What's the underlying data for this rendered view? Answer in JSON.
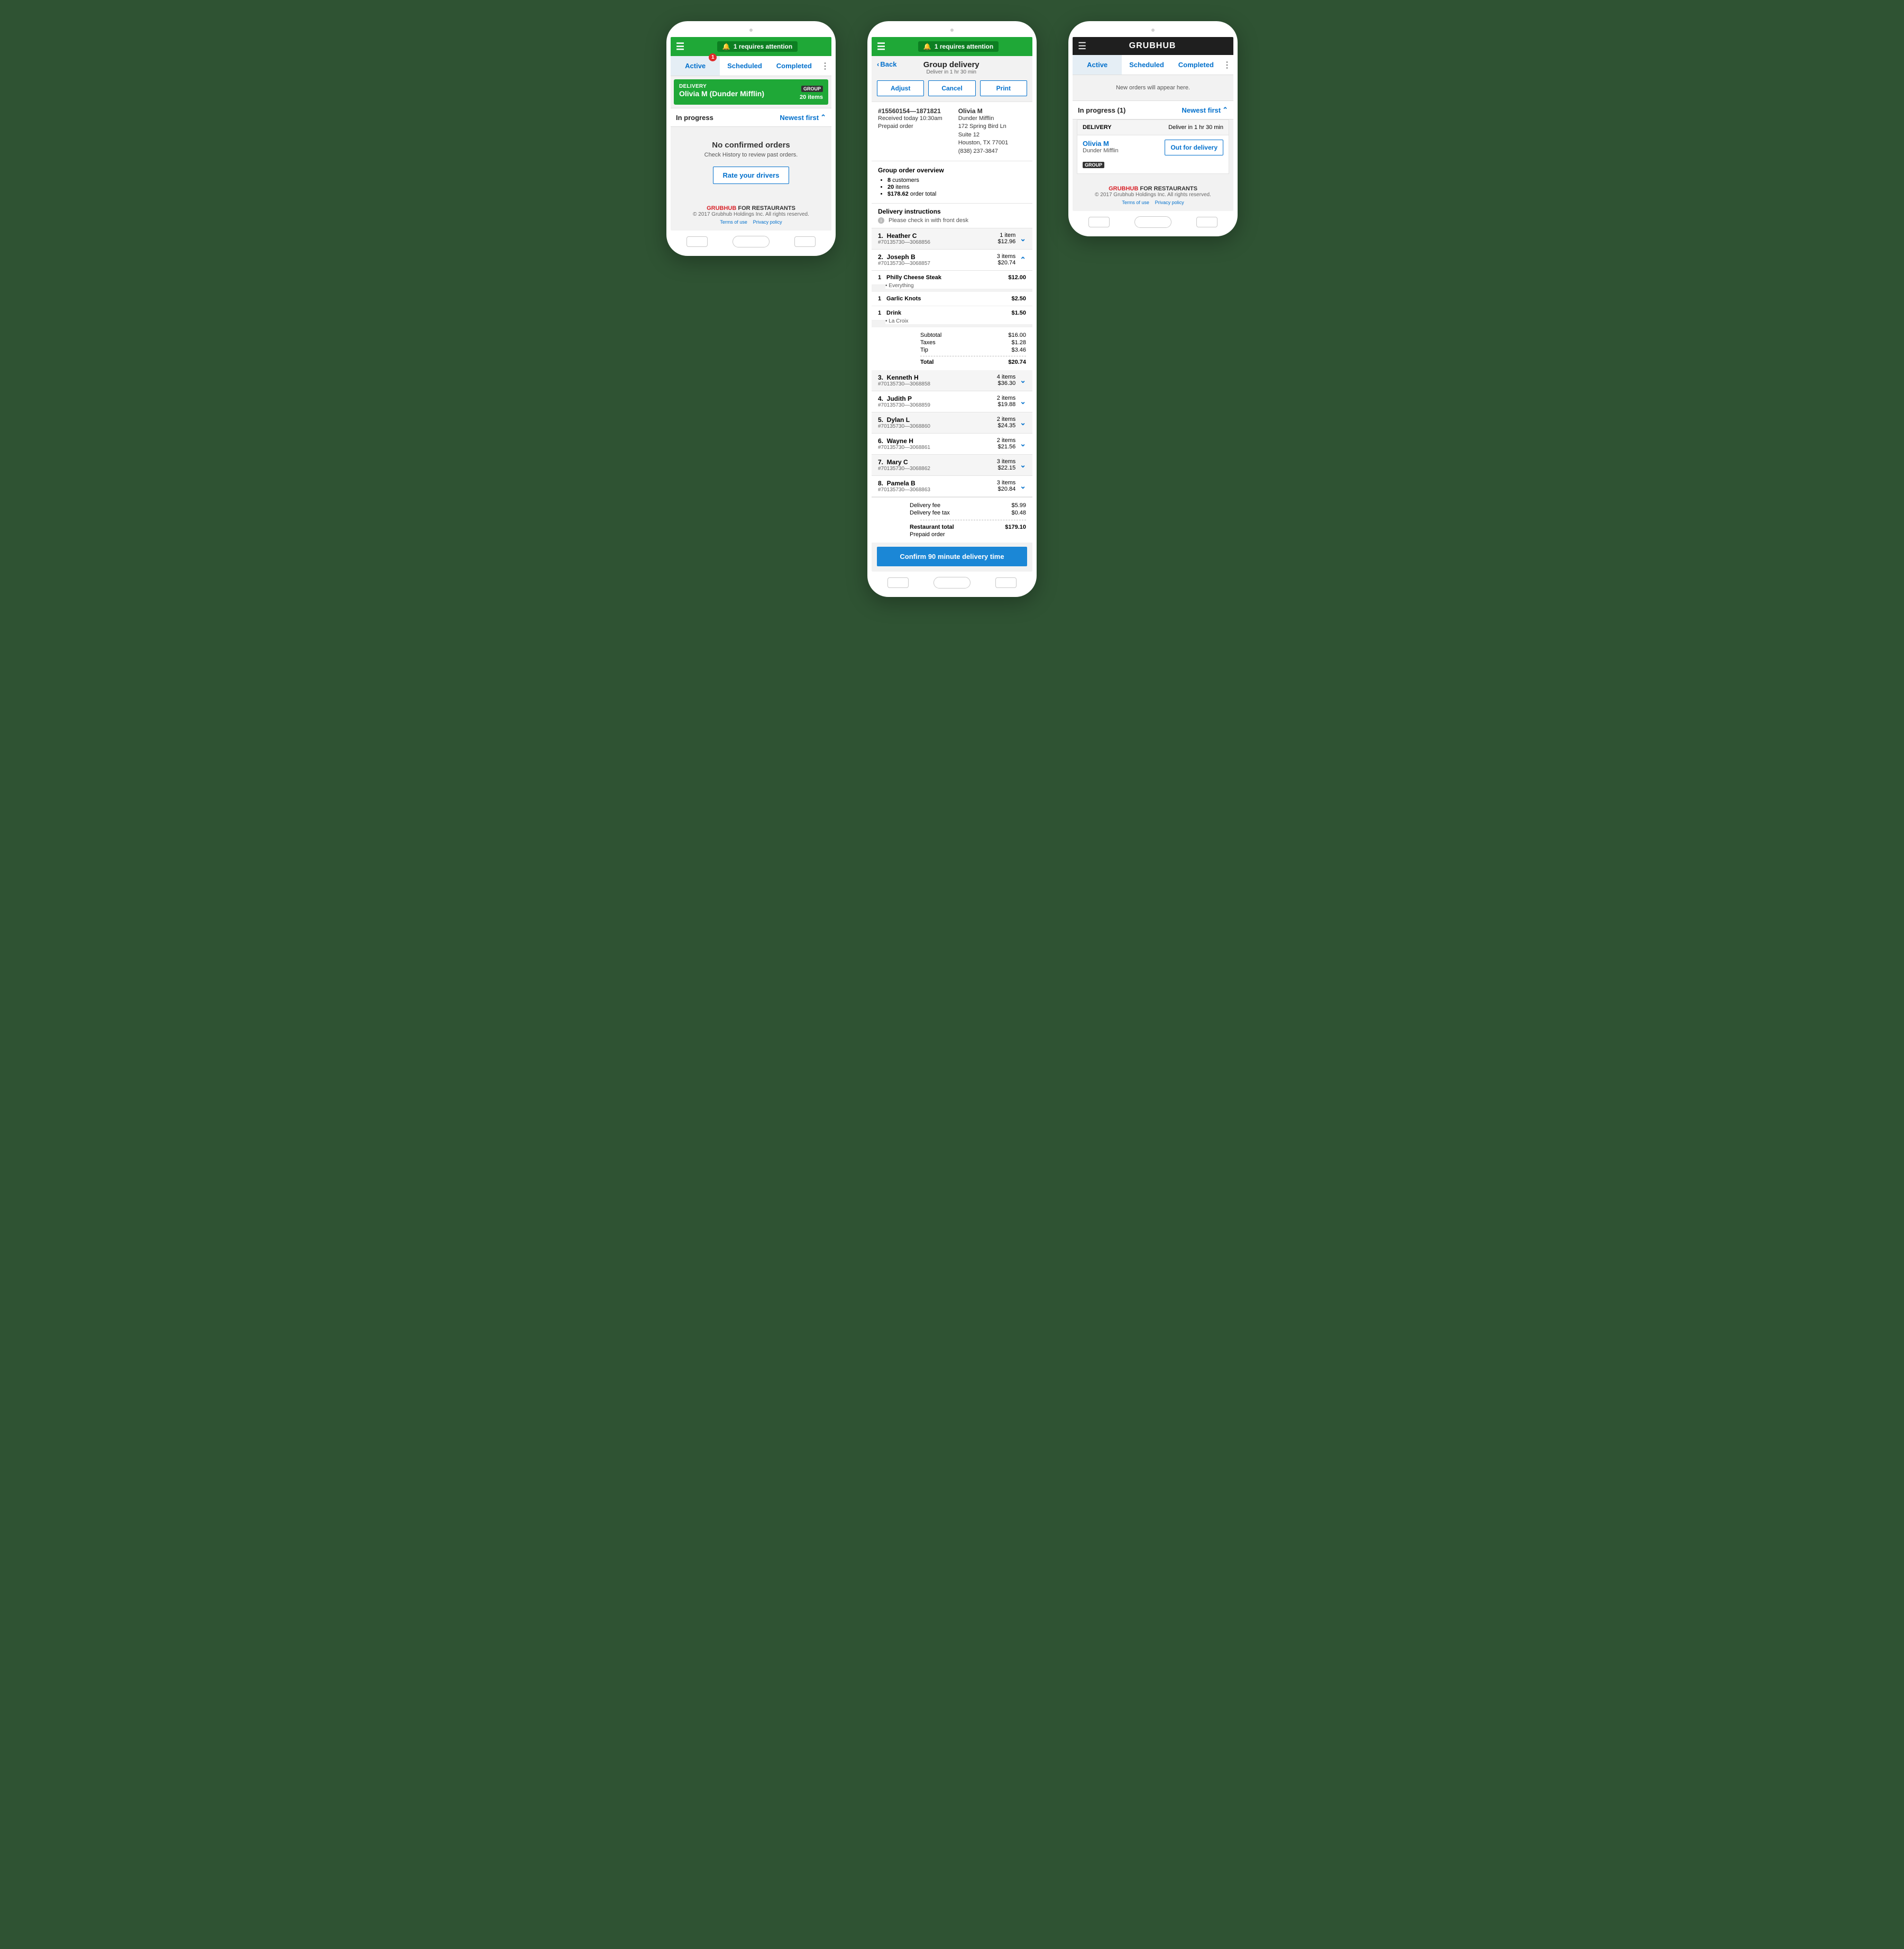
{
  "attention_text": "1 requires attention",
  "tabs": {
    "active": "Active",
    "scheduled": "Scheduled",
    "completed": "Completed",
    "badge": "1"
  },
  "phone1": {
    "card": {
      "type": "DELIVERY",
      "name": "Olivia M (Dunder Mifflin)",
      "badge": "GROUP",
      "items": "20 items"
    },
    "section": {
      "title": "In progress",
      "sort": "Newest first"
    },
    "empty": {
      "title": "No confirmed orders",
      "sub": "Check History to review past orders.",
      "button": "Rate your drivers"
    }
  },
  "footer": {
    "brand_red": "GRUBHUB",
    "brand_rest": " FOR RESTAURANTS",
    "copyright": "© 2017 Grubhub Holdings Inc. All rights reserved.",
    "terms": "Terms of use",
    "privacy": "Privacy policy"
  },
  "phone2": {
    "back": "Back",
    "title": "Group delivery",
    "subtitle": "Deliver in 1 hr 30 min",
    "actions": {
      "adjust": "Adjust",
      "cancel": "Cancel",
      "print": "Print"
    },
    "order_info": {
      "id": "#15560154—1871821",
      "received": "Received today 10:30am",
      "prepaid": "Prepaid order"
    },
    "customer": {
      "name": "Olivia M",
      "company": "Dunder Mifflin",
      "addr1": "172 Spring Bird Ln",
      "addr2": "Suite 12",
      "city": "Houston, TX 77001",
      "phone": "(838) 237-3847"
    },
    "overview": {
      "title": "Group order overview",
      "customers": {
        "n": "8",
        "label": " customers"
      },
      "items": {
        "n": "20",
        "label": " items"
      },
      "total": {
        "n": "$178.62",
        "label": " order total"
      }
    },
    "instructions": {
      "title": "Delivery instructions",
      "text": "Please check in with front desk"
    },
    "people": [
      {
        "idx": "1.",
        "name": "Heather C",
        "id": "#70135730—3068856",
        "count": "1 item",
        "amount": "$12.96",
        "open": false
      },
      {
        "idx": "2.",
        "name": "Joseph B",
        "id": "#70135730—3068857",
        "count": "3 items",
        "amount": "$20.74",
        "open": true
      },
      {
        "idx": "3.",
        "name": "Kenneth H",
        "id": "#70135730—3068858",
        "count": "4 items",
        "amount": "$36.30",
        "open": false
      },
      {
        "idx": "4.",
        "name": "Judith P",
        "id": "#70135730—3068859",
        "count": "2 items",
        "amount": "$19.88",
        "open": false
      },
      {
        "idx": "5.",
        "name": "Dylan L",
        "id": "#70135730—3068860",
        "count": "2 items",
        "amount": "$24.35",
        "open": false
      },
      {
        "idx": "6.",
        "name": "Wayne H",
        "id": "#70135730—3068861",
        "count": "2 items",
        "amount": "$21.56",
        "open": false
      },
      {
        "idx": "7.",
        "name": "Mary C",
        "id": "#70135730—3068862",
        "count": "3 items",
        "amount": "$22.15",
        "open": false
      },
      {
        "idx": "8.",
        "name": "Pamela B",
        "id": "#70135730—3068863",
        "count": "3 items",
        "amount": "$20.84",
        "open": false
      }
    ],
    "joseph_items": [
      {
        "qty": "1",
        "name": "Philly Cheese Steak",
        "price": "$12.00",
        "mods": "Everything"
      },
      {
        "qty": "1",
        "name": "Garlic Knots",
        "price": "$2.50"
      },
      {
        "qty": "1",
        "name": "Drink",
        "price": "$1.50",
        "mods": "La Croix"
      }
    ],
    "joseph_totals": {
      "subtotal_label": "Subtotal",
      "subtotal": "$16.00",
      "taxes_label": "Taxes",
      "taxes": "$1.28",
      "tip_label": "Tip",
      "tip": "$3.46",
      "total_label": "Total",
      "total": "$20.74"
    },
    "fees": {
      "dfee_label": "Delivery fee",
      "dfee": "$5.99",
      "dtax_label": "Delivery fee tax",
      "dtax": "$0.48",
      "rtotal_label": "Restaurant total",
      "rtotal": "$179.10",
      "prepaid": "Prepaid order"
    },
    "confirm": "Confirm 90 minute delivery time"
  },
  "phone3": {
    "brand": "GRUBHUB",
    "new_orders_msg": "New orders will appear here.",
    "section": {
      "title": "In progress (1)",
      "sort": "Newest first"
    },
    "card": {
      "type": "DELIVERY",
      "eta": "Deliver in 1 hr 30 min",
      "name": "Olivia M",
      "company": "Dunder Mifflin",
      "button": "Out for delivery",
      "badge": "GROUP"
    }
  }
}
